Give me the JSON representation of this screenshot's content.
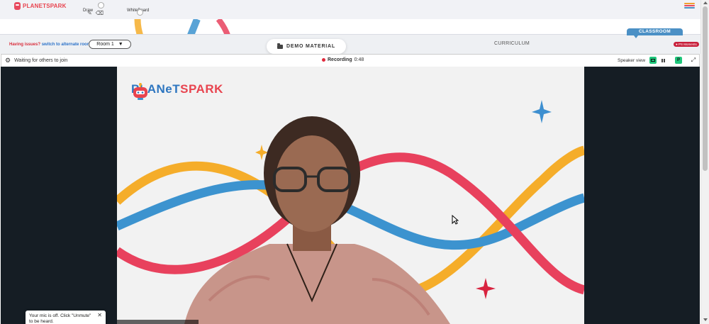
{
  "app": {
    "logo_text": "PLANETSPARK"
  },
  "topbar": {
    "draw_label": "Draw",
    "whiteboard_label": "WhiteBoard",
    "draw_enabled": false,
    "whiteboard_enabled": false,
    "icons": [
      "pencil-icon",
      "eraser-icon",
      "hamburger-menu-icon"
    ],
    "hamburger_colors": [
      "#f0a030",
      "#e84a5f",
      "#4b90c5"
    ]
  },
  "classroom_bar": {
    "issues_text": "Having issues?",
    "alternate_link": "switch to alternate room",
    "room_value": "Room 1",
    "demo_material_label": "DEMO MATERIAL",
    "curriculum_label": "CURRICULUM",
    "classroom_tab_label": "CLASSROOM",
    "ps_moments_label": "PS Moments"
  },
  "meeting_bar": {
    "waiting_text": "Waiting for others to join",
    "recording_label": "Recording",
    "recording_time": "0:48",
    "speaker_view_label": "Speaker view",
    "participant_initial": "P"
  },
  "video": {
    "brand_part1": "PLANeT",
    "brand_part2": "SPARK",
    "colors": {
      "wave_yellow": "#f5ad2a",
      "wave_blue": "#3c93cf",
      "wave_red": "#e8415d",
      "star_blue": "#3d8fd0",
      "star_red": "#d8233f"
    }
  },
  "mic_toast": {
    "message": "Your mic is off. Click \"Unmute\" to be heard."
  },
  "colors": {
    "accent_blue": "#4b90c5",
    "accent_red": "#e8444f",
    "green": "#1ec67b",
    "recording_red": "#e02a3c",
    "stage_bg": "#151d24"
  }
}
